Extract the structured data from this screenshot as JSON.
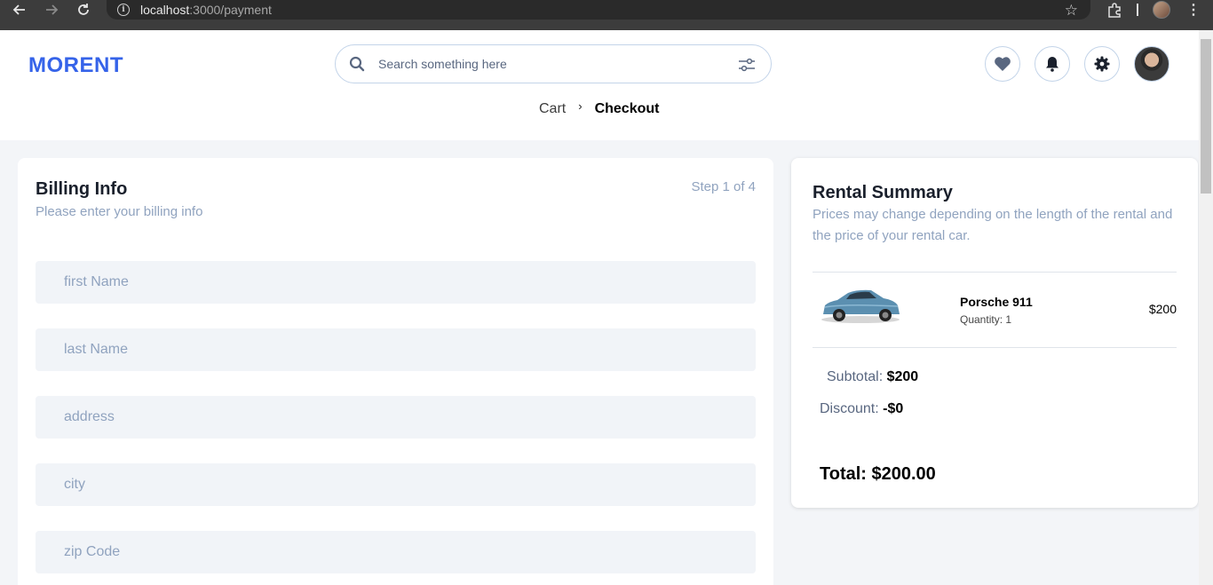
{
  "browser": {
    "url_host": "localhost",
    "url_path": ":3000/payment"
  },
  "header": {
    "logo": "MORENT",
    "search_placeholder": "Search something here"
  },
  "breadcrumb": {
    "cart": "Cart",
    "checkout": "Checkout"
  },
  "billing": {
    "title": "Billing Info",
    "subtitle": "Please enter your billing info",
    "step": "Step 1 of 4",
    "fields": [
      {
        "placeholder": "first Name"
      },
      {
        "placeholder": "last Name"
      },
      {
        "placeholder": "address"
      },
      {
        "placeholder": "city"
      },
      {
        "placeholder": "zip Code"
      }
    ]
  },
  "summary": {
    "title": "Rental Summary",
    "description": "Prices may change depending on the length of the rental and the price of your rental car.",
    "item": {
      "name": "Porsche 911",
      "quantity": "Quantity: 1",
      "price": "$200"
    },
    "subtotal_label": "Subtotal:",
    "subtotal_value": "$200",
    "discount_label": "Discount:",
    "discount_value": "-$0",
    "total": "Total: $200.00"
  },
  "colors": {
    "brand": "#3563e9",
    "muted": "#90a3bf",
    "field_bg": "#f1f4f8"
  }
}
